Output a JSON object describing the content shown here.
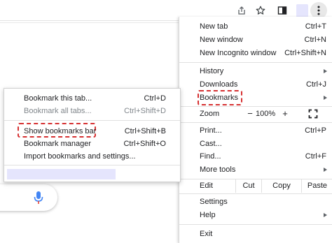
{
  "colors": {
    "highlight_dash": "#d63031",
    "blank_bar": "#e5e5fd",
    "mic_blue": "#4285f4",
    "mic_red": "#ea4335"
  },
  "toolbar": {
    "icons": [
      "share-icon",
      "star-icon",
      "side-panel-icon",
      "profile-avatar",
      "more-menu-icon"
    ]
  },
  "main_menu": {
    "new_tab": {
      "label": "New tab",
      "shortcut": "Ctrl+T"
    },
    "new_window": {
      "label": "New window",
      "shortcut": "Ctrl+N"
    },
    "new_incognito": {
      "label": "New Incognito window",
      "shortcut": "Ctrl+Shift+N"
    },
    "history": {
      "label": "History"
    },
    "downloads": {
      "label": "Downloads",
      "shortcut": "Ctrl+J"
    },
    "bookmarks": {
      "label": "Bookmarks"
    },
    "zoom": {
      "label": "Zoom",
      "minus": "−",
      "value": "100%",
      "plus": "+"
    },
    "print": {
      "label": "Print...",
      "shortcut": "Ctrl+P"
    },
    "cast": {
      "label": "Cast..."
    },
    "find": {
      "label": "Find...",
      "shortcut": "Ctrl+F"
    },
    "more_tools": {
      "label": "More tools"
    },
    "edit": {
      "label": "Edit",
      "cut": "Cut",
      "copy": "Copy",
      "paste": "Paste"
    },
    "settings": {
      "label": "Settings"
    },
    "help": {
      "label": "Help"
    },
    "exit": {
      "label": "Exit"
    }
  },
  "bookmarks_submenu": {
    "bookmark_tab": {
      "label": "Bookmark this tab...",
      "shortcut": "Ctrl+D"
    },
    "bookmark_all": {
      "label": "Bookmark all tabs...",
      "shortcut": "Ctrl+Shift+D"
    },
    "show_bar": {
      "label": "Show bookmarks bar",
      "shortcut": "Ctrl+Shift+B"
    },
    "manager": {
      "label": "Bookmark manager",
      "shortcut": "Ctrl+Shift+O"
    },
    "import": {
      "label": "Import bookmarks and settings..."
    }
  }
}
